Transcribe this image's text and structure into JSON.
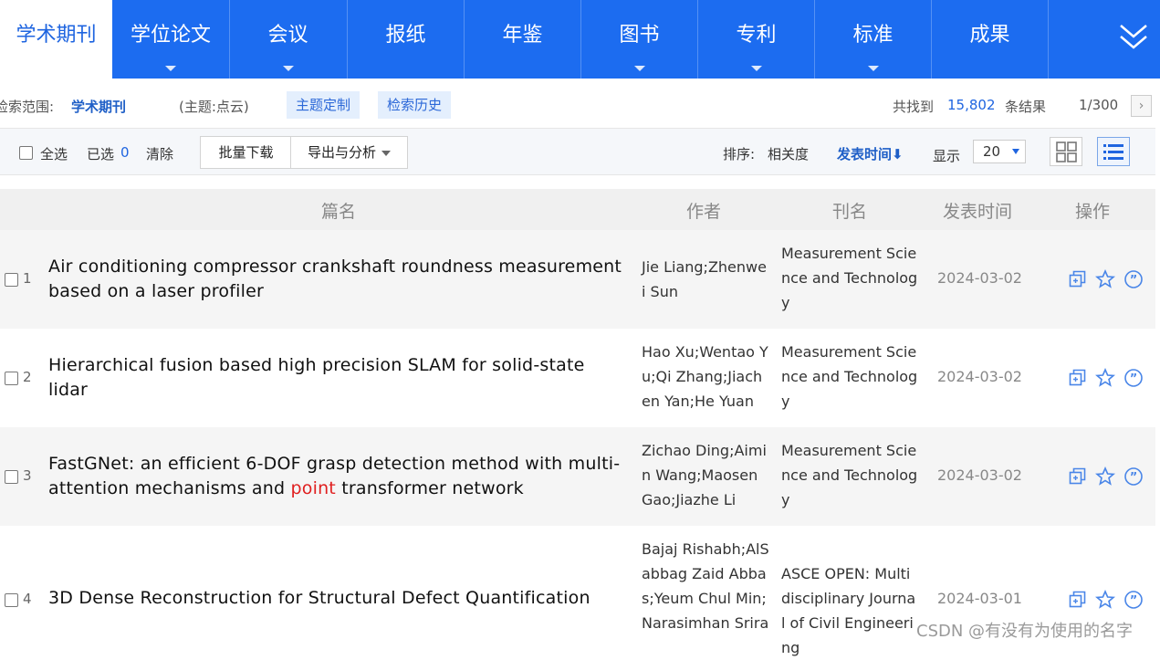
{
  "nav": {
    "tabs": [
      {
        "label": "学术期刊",
        "active": true,
        "caret": false
      },
      {
        "label": "学位论文",
        "active": false,
        "caret": true
      },
      {
        "label": "会议",
        "active": false,
        "caret": true
      },
      {
        "label": "报纸",
        "active": false,
        "caret": false
      },
      {
        "label": "年鉴",
        "active": false,
        "caret": false
      },
      {
        "label": "图书",
        "active": false,
        "caret": true
      },
      {
        "label": "专利",
        "active": false,
        "caret": true
      },
      {
        "label": "标准",
        "active": false,
        "caret": true
      },
      {
        "label": "成果",
        "active": false,
        "caret": false
      }
    ],
    "more_icon": "double-chevron-down-icon"
  },
  "search": {
    "scope_label": "检索范围:",
    "scope_value": "学术期刊",
    "topic": "(主题:点云)",
    "custom_topic": "主题定制",
    "history": "检索历史",
    "found_label": "共找到",
    "found_count": "15,802",
    "found_unit": "条结果",
    "page": "1/300",
    "next": "›"
  },
  "toolbar": {
    "select_all": "全选",
    "selected_label": "已选",
    "selected_count": "0",
    "clear": "清除",
    "batch_download": "批量下载",
    "export_analysis": "导出与分析",
    "sort_label": "排序:",
    "sort_relevance": "相关度",
    "sort_time": "发表时间⬇",
    "display_label": "显示",
    "per_page": "20"
  },
  "table": {
    "headers": {
      "title": "篇名",
      "author": "作者",
      "journal": "刊名",
      "date": "发表时间",
      "ops": "操作"
    },
    "rows": [
      {
        "num": "1",
        "title_pre": "Air conditioning compressor crankshaft roundness measurement based on a laser profiler",
        "title_hl": "",
        "title_post": "",
        "authors": "Jie Liang;Zhenwei Sun",
        "journal": "Measurement Science and Technology",
        "date": "2024-03-02"
      },
      {
        "num": "2",
        "title_pre": "Hierarchical fusion based high precision SLAM for solid-state lidar",
        "title_hl": "",
        "title_post": "",
        "authors": "Hao Xu;Wentao Yu;Qi Zhang;Jiachen Yan;He Yuan",
        "journal": "Measurement Science and Technology",
        "date": "2024-03-02"
      },
      {
        "num": "3",
        "title_pre": "FastGNet: an efficient 6-DOF grasp detection method with multi-attention mechanisms and ",
        "title_hl": "point",
        "title_post": " transformer network",
        "authors": "Zichao Ding;Aimin Wang;Maosen Gao;Jiazhe Li",
        "journal": "Measurement Science and Technology",
        "date": "2024-03-02"
      },
      {
        "num": "4",
        "title_pre": "3D Dense Reconstruction for Structural Defect Quantification",
        "title_hl": "",
        "title_post": "",
        "authors": "Bajaj Rishabh;AlSabbag Zaid Abbas;Yeum Chul Min;Narasimhan Srira",
        "journal": "ASCE OPEN: Multidisciplinary Journal of Civil Engineering",
        "date": "2024-03-01"
      }
    ]
  },
  "watermark": "CSDN @有没有为使用的名字",
  "colors": {
    "nav_bg": "#1c6cf0",
    "accent": "#1f65e0",
    "highlight": "#e02020"
  }
}
